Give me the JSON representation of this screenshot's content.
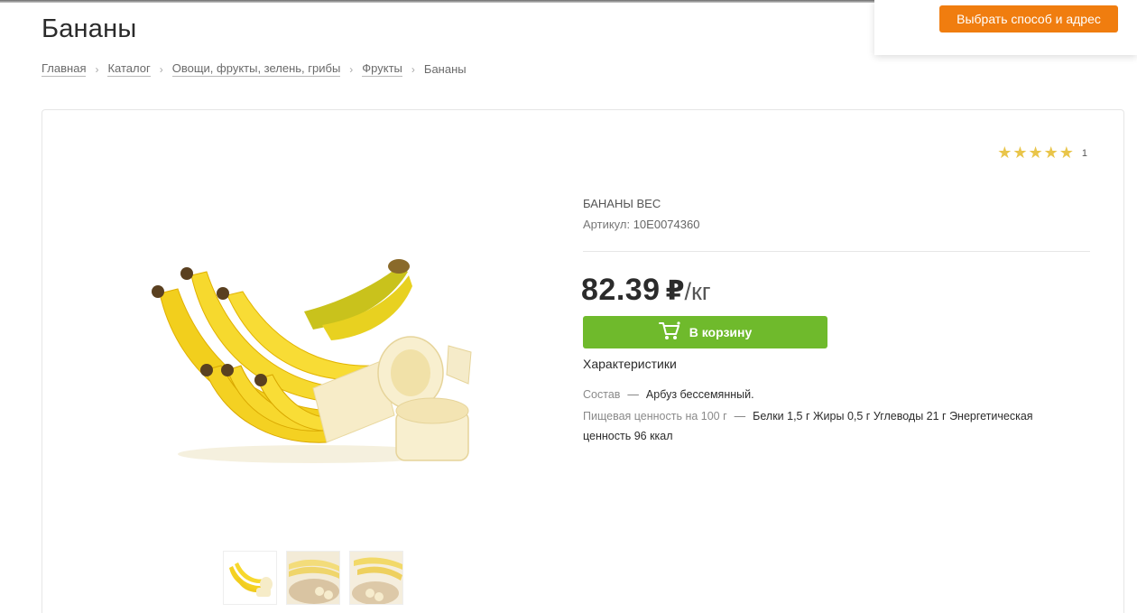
{
  "page": {
    "title": "Бананы"
  },
  "breadcrumb": {
    "items": [
      "Главная",
      "Каталог",
      "Овощи, фрукты, зелень, грибы",
      "Фрукты"
    ],
    "current": "Бананы"
  },
  "header": {
    "delivery_button": "Выбрать способ и адрес"
  },
  "product": {
    "name": "БАНАНЫ ВЕС",
    "article_label": "Артикул:",
    "article_value": "10E0074360",
    "rating_stars": "★★★★★",
    "rating_value": 5,
    "rating_count": "1",
    "price_value": "82.39",
    "price_currency": "₽",
    "price_unit": "/кг",
    "cart_button": "В корзину",
    "specs_title": "Характеристики",
    "specs": [
      {
        "label": "Состав",
        "value": "Арбуз бессемянный."
      },
      {
        "label": "Пищевая ценность на 100 г",
        "value": "Белки 1,5 г Жиры 0,5 г Углеводы 21 г Энергетическая ценность 96 ккал"
      }
    ],
    "thumbnails": [
      "banana-bunch-thumb",
      "banana-board-thumb",
      "banana-board-thumb-2"
    ]
  },
  "colors": {
    "accent_orange": "#f07d0f",
    "cart_green": "#6fba2c",
    "star_gold": "#e9c54a",
    "banana_yellow": "#f5d32a"
  }
}
